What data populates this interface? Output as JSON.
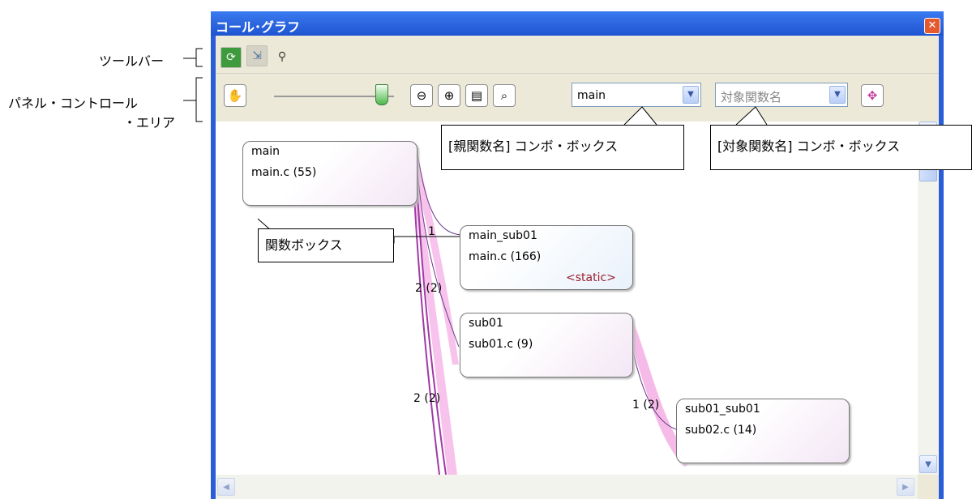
{
  "window": {
    "title": "コール･グラフ",
    "close_icon": "close-icon"
  },
  "toolbar": {
    "buttons": [
      {
        "icon": "refresh-icon"
      },
      {
        "icon": "layout-icon"
      },
      {
        "icon": "binoculars-icon"
      }
    ]
  },
  "panel": {
    "hand_icon": "hand-icon",
    "zoom_slider": {
      "level": 0.9
    },
    "buttons": [
      {
        "icon": "zoom-out-icon"
      },
      {
        "icon": "zoom-in-icon"
      },
      {
        "icon": "fit-page-icon"
      },
      {
        "icon": "search-icon"
      }
    ],
    "parent_combo": {
      "value": "main"
    },
    "target_combo": {
      "placeholder": "対象関数名"
    },
    "jump_icon": "graph-jump-icon"
  },
  "graph": {
    "boxes": [
      {
        "name": "main",
        "file": "main.c (55)",
        "static": ""
      },
      {
        "name": "main_sub01",
        "file": "main.c (166)",
        "static": "<static>"
      },
      {
        "name": "sub01",
        "file": "sub01.c (9)",
        "static": ""
      },
      {
        "name": "sub01_sub01",
        "file": "sub02.c (14)",
        "static": ""
      }
    ],
    "edge_labels": [
      "1",
      "2 (2)",
      "2 (2)",
      "1 (2)"
    ]
  },
  "annotations": {
    "toolbar": "ツールバー",
    "panel_line1": "パネル・コントロール",
    "panel_line2": "・エリア",
    "parent_combo": "[親関数名] コンボ・ボックス",
    "target_combo": "[対象関数名] コンボ・ボックス",
    "function_box": "関数ボックス"
  },
  "colors": {
    "title_bar": "#2a5ed8",
    "static_text": "#9a1f2e",
    "edge_highlight": "#f5b3e6"
  }
}
